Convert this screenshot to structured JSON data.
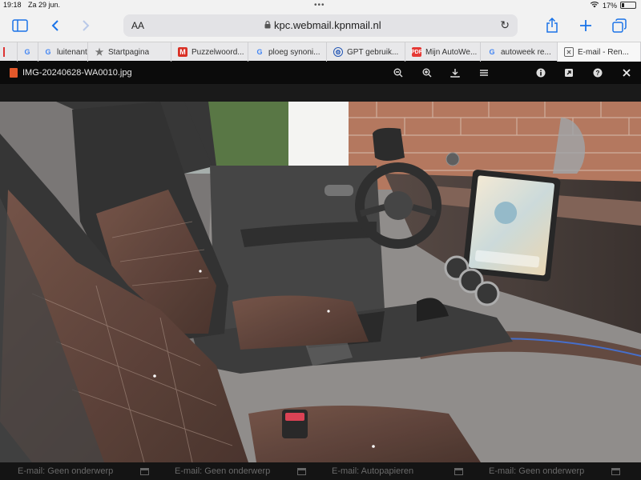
{
  "status": {
    "time": "19:18",
    "date": "Za 29 jun.",
    "battery": "17%",
    "battery_level": 0.17
  },
  "browser": {
    "text_size_label": "AA",
    "url": "kpc.webmail.kpnmail.nl",
    "icons": {
      "sidebar": "sidebar-icon",
      "back": "chevron-left-icon",
      "forward": "chevron-right-icon",
      "lock": "lock-icon",
      "reload": "reload-icon",
      "share": "share-icon",
      "new_tab": "plus-icon",
      "tabs": "tabs-icon"
    }
  },
  "tabs": [
    {
      "label": "",
      "favicon": "G"
    },
    {
      "label": "luitenant",
      "favicon": "G"
    },
    {
      "label": "Startpagina",
      "favicon": "★"
    },
    {
      "label": "Puzzelwoord...",
      "favicon": "M"
    },
    {
      "label": "ploeg synoni...",
      "favicon": "G"
    },
    {
      "label": "GPT gebruik...",
      "favicon": "⚙"
    },
    {
      "label": "Mijn AutoWe...",
      "favicon": "PDF"
    },
    {
      "label": "autoweek re...",
      "favicon": "G"
    },
    {
      "label": "E-mail - Ren...",
      "favicon": "✕"
    }
  ],
  "viewer": {
    "filename": "IMG-20240628-WA0010.jpg",
    "image_alt": "Interior of a car with brown leather seats and a large central touchscreen"
  },
  "minimized": [
    {
      "label": "E-mail: Geen onderwerp"
    },
    {
      "label": "E-mail: Geen onderwerp"
    },
    {
      "label": "E-mail: Autopapieren"
    },
    {
      "label": "E-mail: Geen onderwerp"
    }
  ],
  "colors": {
    "accent": "#1a73e8",
    "leather": "#5a3a30",
    "viewer_bg": "#0b0b0b"
  }
}
